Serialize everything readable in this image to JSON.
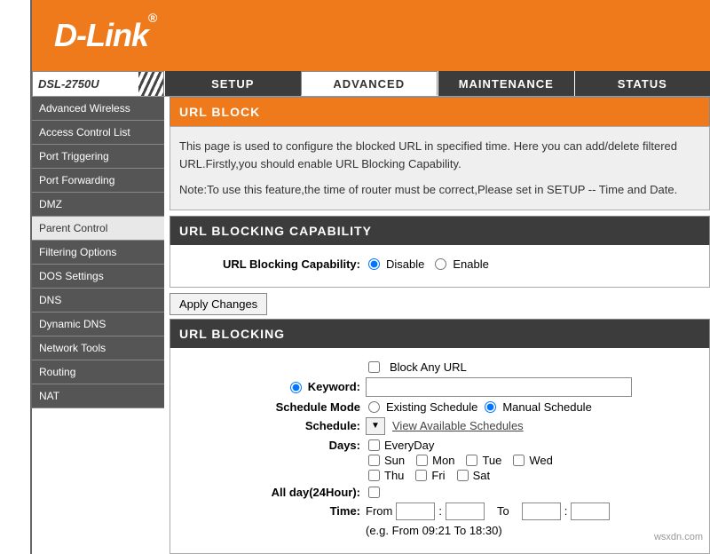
{
  "brand": "D-Link",
  "model": "DSL-2750U",
  "tabs": {
    "setup": "SETUP",
    "advanced": "ADVANCED",
    "maintenance": "MAINTENANCE",
    "status": "STATUS"
  },
  "sidebar": {
    "items": [
      "Advanced Wireless",
      "Access Control List",
      "Port Triggering",
      "Port Forwarding",
      "DMZ",
      "Parent Control",
      "Filtering Options",
      "DOS Settings",
      "DNS",
      "Dynamic DNS",
      "Network Tools",
      "Routing",
      "NAT"
    ]
  },
  "urlblock": {
    "title": "URL BLOCK",
    "desc1": "This page is used to configure the blocked URL in specified time. Here you can add/delete filtered URL.Firstly,you should enable URL Blocking Capability.",
    "desc2": "Note:To use this feature,the time of router must be correct,Please set in SETUP -- Time and Date."
  },
  "cap": {
    "title": "URL BLOCKING CAPABILITY",
    "label": "URL Blocking Capability:",
    "disable": "Disable",
    "enable": "Enable",
    "apply": "Apply Changes"
  },
  "blk": {
    "title": "URL BLOCKING",
    "blockany": "Block Any URL",
    "keyword": "Keyword:",
    "schedmode": "Schedule Mode",
    "existing": "Existing Schedule",
    "manual": "Manual Schedule",
    "schedule": "Schedule:",
    "viewavail": "View Available Schedules",
    "days": "Days:",
    "everyday": "EveryDay",
    "sun": "Sun",
    "mon": "Mon",
    "tue": "Tue",
    "wed": "Wed",
    "thu": "Thu",
    "fri": "Fri",
    "sat": "Sat",
    "allday": "All day(24Hour):",
    "time": "Time:",
    "from": "From",
    "to": "To",
    "eg": "(e.g. From 09:21 To 18:30)"
  },
  "watermark": "wsxdn.com"
}
